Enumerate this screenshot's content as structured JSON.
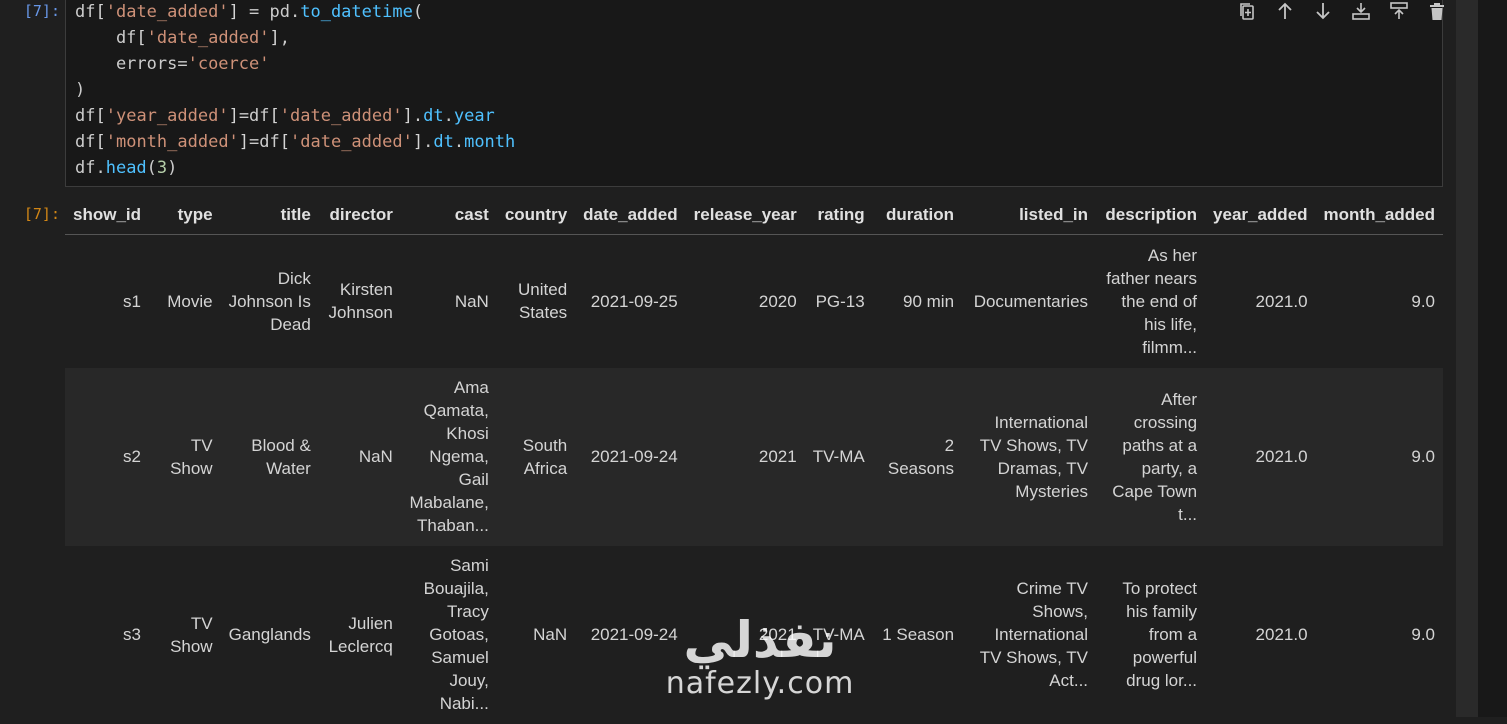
{
  "input_prompt": "[7]:",
  "output_prompt": "[7]:",
  "toolbar": [
    {
      "icon": "split-cell-icon",
      "title": "Split cell"
    },
    {
      "icon": "move-up-icon",
      "title": "Move up"
    },
    {
      "icon": "move-down-icon",
      "title": "Move down"
    },
    {
      "icon": "insert-below-icon",
      "title": "Insert below"
    },
    {
      "icon": "insert-above-icon",
      "title": "Insert above"
    },
    {
      "icon": "trash-icon",
      "title": "Delete"
    }
  ],
  "code_lines": [
    "df['date_added'] = pd.to_datetime(",
    "    df['date_added'],",
    "    errors='coerce'",
    ")",
    "df['year_added']=df['date_added'].dt.year",
    "df['month_added']=df['date_added'].dt.month",
    "df.head(3)"
  ],
  "table": {
    "columns": [
      "show_id",
      "type",
      "title",
      "director",
      "cast",
      "country",
      "date_added",
      "release_year",
      "rating",
      "duration",
      "listed_in",
      "description",
      "year_added",
      "month_added"
    ],
    "rows": [
      [
        "s1",
        "Movie",
        "Dick Johnson Is Dead",
        "Kirsten Johnson",
        "NaN",
        "United States",
        "2021-09-25",
        "2020",
        "PG-13",
        "90 min",
        "Documentaries",
        "As her father nears the end of his life, filmm...",
        "2021.0",
        "9.0"
      ],
      [
        "s2",
        "TV Show",
        "Blood & Water",
        "NaN",
        "Ama Qamata, Khosi Ngema, Gail Mabalane, Thaban...",
        "South Africa",
        "2021-09-24",
        "2021",
        "TV-MA",
        "2 Seasons",
        "International TV Shows, TV Dramas, TV Mysteries",
        "After crossing paths at a party, a Cape Town t...",
        "2021.0",
        "9.0"
      ],
      [
        "s3",
        "TV Show",
        "Ganglands",
        "Julien Leclercq",
        "Sami Bouajila, Tracy Gotoas, Samuel Jouy, Nabi...",
        "NaN",
        "2021-09-24",
        "2021",
        "TV-MA",
        "1 Season",
        "Crime TV Shows, International TV Shows, TV Act...",
        "To protect his family from a powerful drug lor...",
        "2021.0",
        "9.0"
      ]
    ]
  },
  "watermark": {
    "arabic": "نفذلي",
    "latin": "nafezly.com"
  }
}
